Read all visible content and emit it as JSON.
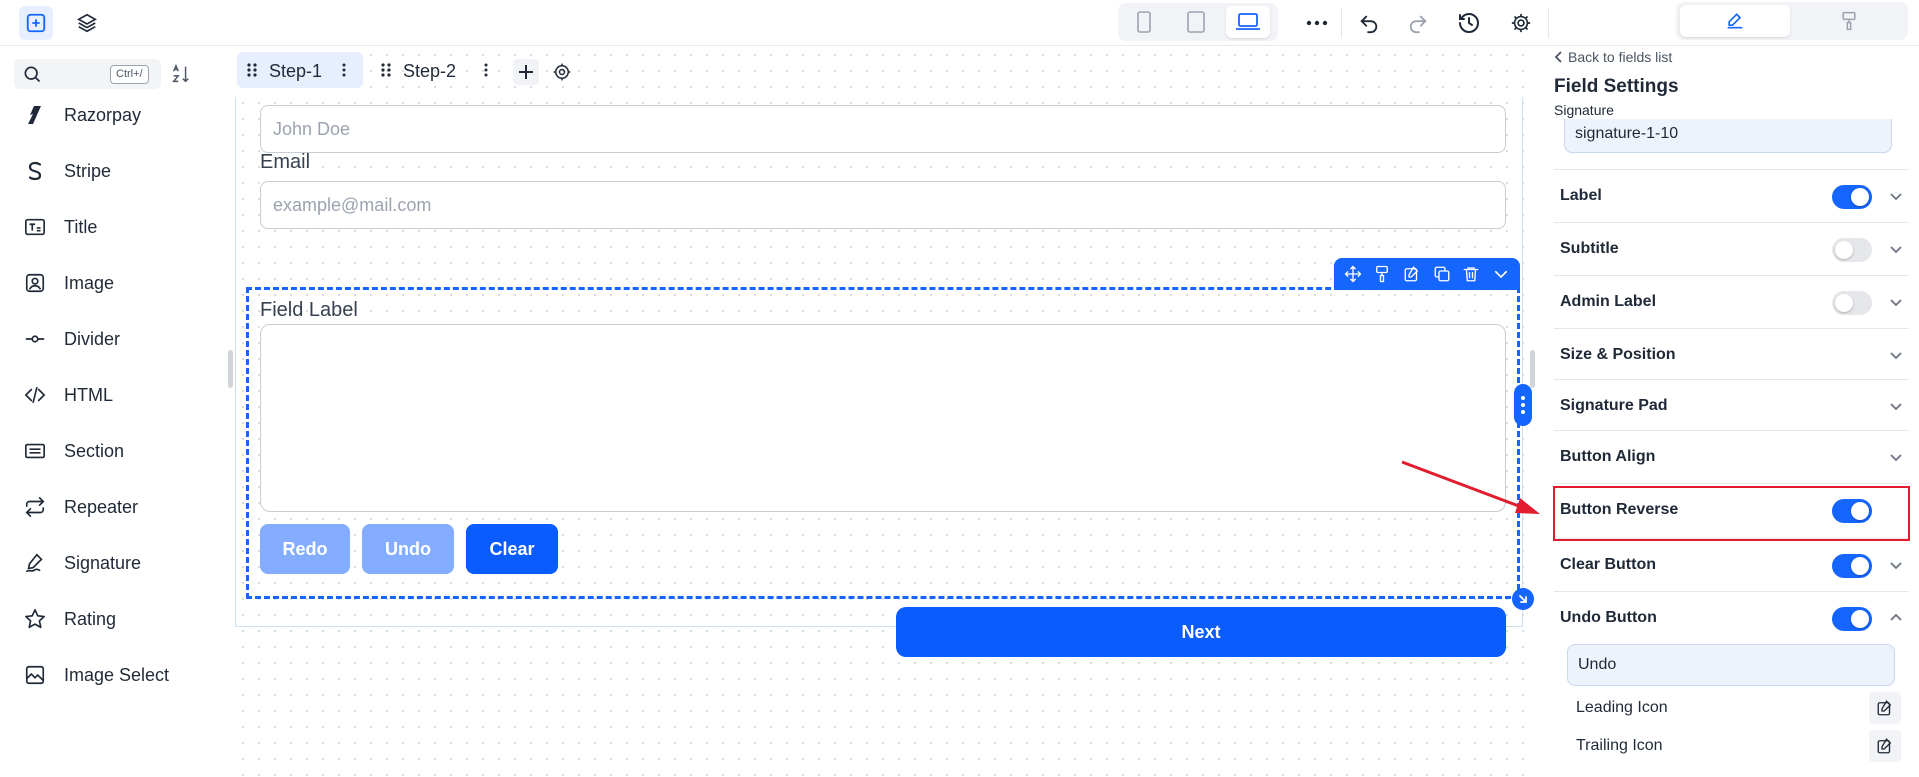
{
  "search": {
    "shortcut": "Ctrl+/"
  },
  "sidebar": {
    "items": [
      {
        "label": "Razorpay",
        "icon": "razorpay-icon"
      },
      {
        "label": "Stripe",
        "icon": "stripe-icon"
      },
      {
        "label": "Title",
        "icon": "title-icon"
      },
      {
        "label": "Image",
        "icon": "image-icon"
      },
      {
        "label": "Divider",
        "icon": "divider-icon"
      },
      {
        "label": "HTML",
        "icon": "code-icon"
      },
      {
        "label": "Section",
        "icon": "section-icon"
      },
      {
        "label": "Repeater",
        "icon": "repeat-icon"
      },
      {
        "label": "Signature",
        "icon": "signature-icon"
      },
      {
        "label": "Rating",
        "icon": "star-icon"
      },
      {
        "label": "Image Select",
        "icon": "image-select-icon"
      }
    ]
  },
  "steps": [
    {
      "label": "Step-1"
    },
    {
      "label": "Step-2"
    }
  ],
  "form": {
    "name_placeholder": "John Doe",
    "email_label": "Email",
    "email_placeholder": "example@mail.com",
    "field_label": "Field Label",
    "buttons": {
      "redo": "Redo",
      "undo": "Undo",
      "clear": "Clear"
    },
    "next": "Next"
  },
  "panel": {
    "back": "Back to fields list",
    "title": "Field Settings",
    "subtitle": "Signature",
    "field_key": "signature-1-10",
    "rows": [
      {
        "label": "Label",
        "toggle": "on",
        "chevron": "down"
      },
      {
        "label": "Subtitle",
        "toggle": "off",
        "chevron": "down"
      },
      {
        "label": "Admin Label",
        "toggle": "off",
        "chevron": "down"
      },
      {
        "label": "Size & Position",
        "toggle": null,
        "chevron": "down"
      },
      {
        "label": "Signature Pad",
        "toggle": null,
        "chevron": "down"
      },
      {
        "label": "Button Align",
        "toggle": null,
        "chevron": "down"
      },
      {
        "label": "Button Reverse",
        "toggle": "on",
        "chevron": null
      },
      {
        "label": "Clear Button",
        "toggle": "on",
        "chevron": "down"
      },
      {
        "label": "Undo Button",
        "toggle": "on",
        "chevron": "up"
      }
    ],
    "undo_text": "Undo",
    "leading_icon": "Leading Icon",
    "trailing_icon": "Trailing Icon"
  },
  "colors": {
    "accent": "#1565ff",
    "highlight": "#e11d2e",
    "disabled_button": "#84adff"
  }
}
